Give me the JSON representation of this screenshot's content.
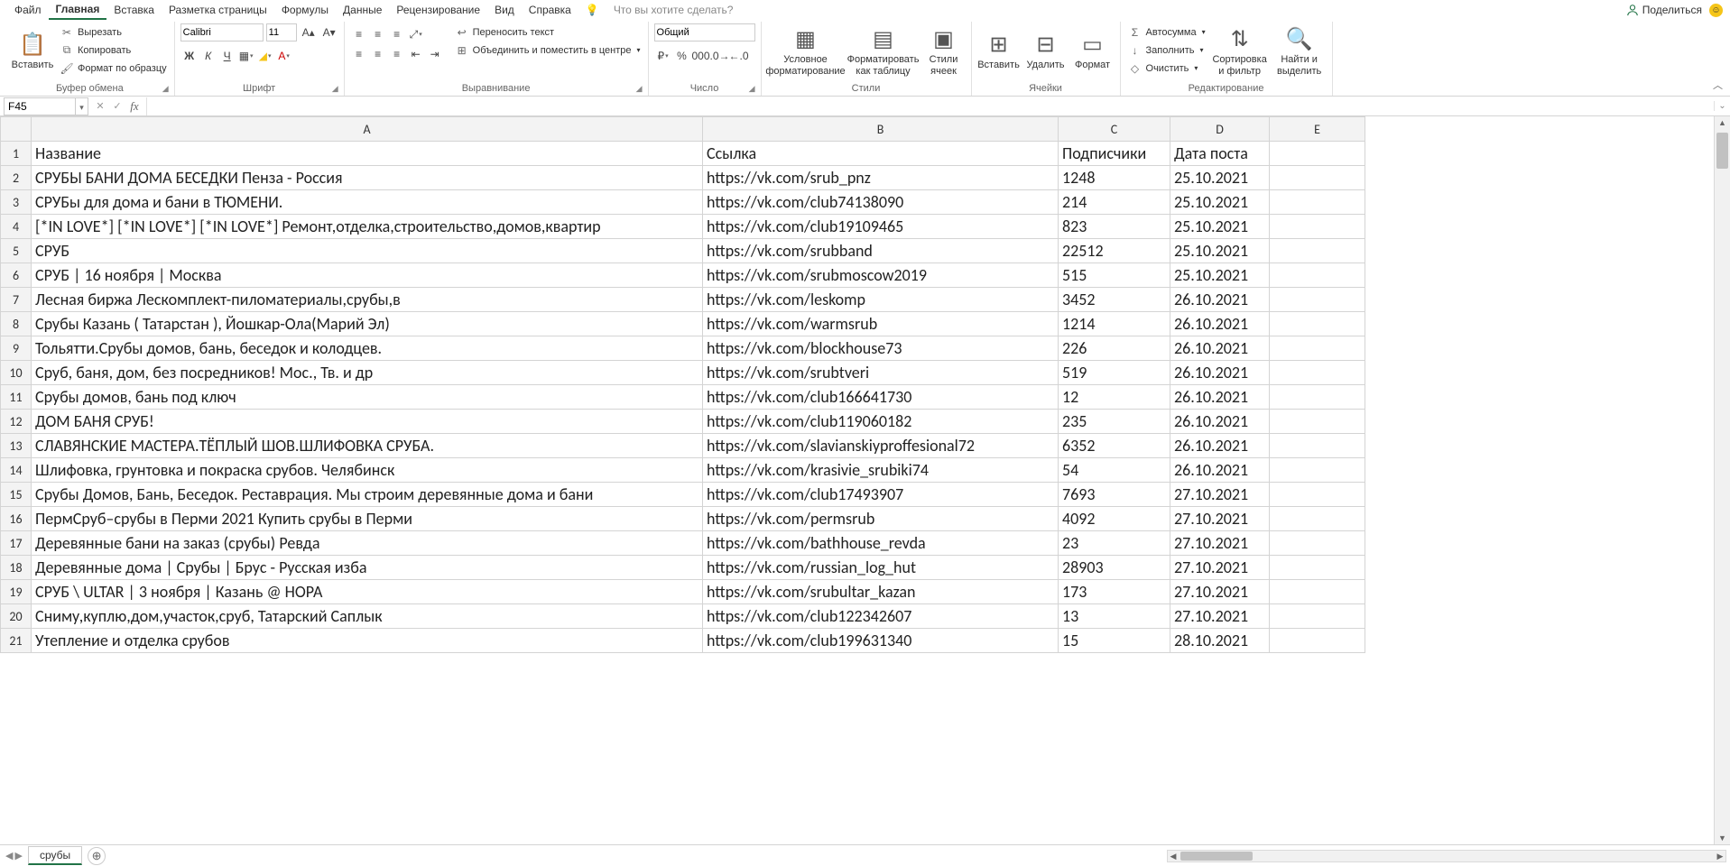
{
  "menu": {
    "tabs": [
      "Файл",
      "Главная",
      "Вставка",
      "Разметка страницы",
      "Формулы",
      "Данные",
      "Рецензирование",
      "Вид",
      "Справка"
    ],
    "active_index": 1,
    "tell_me": "Что вы хотите сделать?",
    "share": "Поделиться"
  },
  "ribbon": {
    "clipboard": {
      "paste": "Вставить",
      "cut": "Вырезать",
      "copy": "Копировать",
      "format_painter": "Формат по образцу",
      "label": "Буфер обмена"
    },
    "font": {
      "name": "Calibri",
      "size": "11",
      "label": "Шрифт"
    },
    "alignment": {
      "wrap": "Переносить текст",
      "merge": "Объединить и поместить в центре",
      "label": "Выравнивание"
    },
    "number": {
      "format": "Общий",
      "label": "Число"
    },
    "styles": {
      "conditional": "Условное форматирование",
      "as_table": "Форматировать как таблицу",
      "cell_styles": "Стили ячеек",
      "label": "Стили"
    },
    "cells": {
      "insert": "Вставить",
      "delete": "Удалить",
      "format": "Формат",
      "label": "Ячейки"
    },
    "editing": {
      "autosum": "Автосумма",
      "fill": "Заполнить",
      "clear": "Очистить",
      "sort": "Сортировка и фильтр",
      "find": "Найти и выделить",
      "label": "Редактирование"
    }
  },
  "namebox": "F45",
  "formula": "",
  "columns": [
    "A",
    "B",
    "C",
    "D",
    "E"
  ],
  "headers": {
    "A": "Название",
    "B": "Ссылка",
    "C": "Подписчики",
    "D": "Дата поста"
  },
  "rows": [
    {
      "n": 1,
      "A": "Название",
      "B": "Ссылка",
      "C": "Подписчики",
      "CT": "text",
      "D": "Дата поста"
    },
    {
      "n": 2,
      "A": "СРУБЫ БАНИ ДОМА БЕСЕДКИ Пенза - Россия",
      "B": "https://vk.com/srub_pnz",
      "C": "1248",
      "D": "25.10.2021"
    },
    {
      "n": 3,
      "A": "СРУБы для дома и бани в ТЮМЕНИ.",
      "B": "https://vk.com/club74138090",
      "C": "214",
      "D": "25.10.2021"
    },
    {
      "n": 4,
      "A": "[*IN LOVE*] [*IN LOVE*] [*IN LOVE*] Ремонт,отделка,строительство,домов,квартир",
      "B": "https://vk.com/club19109465",
      "C": "823",
      "D": "25.10.2021"
    },
    {
      "n": 5,
      "A": "СРУБ",
      "B": "https://vk.com/srubband",
      "C": "22512",
      "D": "25.10.2021"
    },
    {
      "n": 6,
      "A": "СРУБ | 16 ноября | Москва",
      "B": "https://vk.com/srubmoscow2019",
      "C": "515",
      "D": "25.10.2021"
    },
    {
      "n": 7,
      "A": "Лесная биржа Лескомплект-пиломатериалы,срубы,в",
      "B": "https://vk.com/leskomp",
      "C": "3452",
      "D": "26.10.2021"
    },
    {
      "n": 8,
      "A": "Срубы Казань ( Татарстан ), Йошкар-Ола(Марий Эл)",
      "B": "https://vk.com/warmsrub",
      "C": "1214",
      "D": "26.10.2021"
    },
    {
      "n": 9,
      "A": "Тольятти.Срубы домов, бань, беседок и колодцев.",
      "B": "https://vk.com/blockhouse73",
      "C": "226",
      "D": "26.10.2021"
    },
    {
      "n": 10,
      "A": "Сруб, баня, дом, без посредников! Мос., Тв. и др",
      "B": "https://vk.com/srubtveri",
      "C": "519",
      "D": "26.10.2021"
    },
    {
      "n": 11,
      "A": "Срубы домов, бань под ключ",
      "B": "https://vk.com/club166641730",
      "C": "12",
      "D": "26.10.2021"
    },
    {
      "n": 12,
      "A": "ДОМ БАНЯ СРУБ!",
      "B": "https://vk.com/club119060182",
      "C": "235",
      "D": "26.10.2021"
    },
    {
      "n": 13,
      "A": "СЛАВЯНСКИЕ МАСТЕРА.ТЁПЛЫЙ ШОВ.ШЛИФОВКА СРУБА.",
      "B": "https://vk.com/slavianskiyproffesional72",
      "C": "6352",
      "D": "26.10.2021"
    },
    {
      "n": 14,
      "A": "Шлифовка, грунтовка и покраска срубов. Челябинск",
      "B": "https://vk.com/krasivie_srubiki74",
      "C": "54",
      "D": "26.10.2021"
    },
    {
      "n": 15,
      "A": "Срубы Домов, Бань, Беседок. Реставрация. Мы строим деревянные дома и бани",
      "B": "https://vk.com/club17493907",
      "C": "7693",
      "D": "27.10.2021"
    },
    {
      "n": 16,
      "A": "ПермСруб–срубы в Перми 2021 Купить срубы в Перми",
      "B": "https://vk.com/permsrub",
      "C": "4092",
      "D": "27.10.2021"
    },
    {
      "n": 17,
      "A": "Деревянные бани на заказ (срубы) Ревда",
      "B": "https://vk.com/bathhouse_revda",
      "C": "23",
      "D": "27.10.2021"
    },
    {
      "n": 18,
      "A": "Деревянные дома | Срубы | Брус - Русская изба",
      "B": "https://vk.com/russian_log_hut",
      "C": "28903",
      "D": "27.10.2021"
    },
    {
      "n": 19,
      "A": "СРУБ \\ ULTAR | 3 ноября | Казань @ НОРА",
      "B": "https://vk.com/srubultar_kazan",
      "C": "173",
      "D": "27.10.2021"
    },
    {
      "n": 20,
      "A": "Сниму,куплю,дом,участок,сруб, Татарский Саплык",
      "B": "https://vk.com/club122342607",
      "C": "13",
      "D": "27.10.2021"
    },
    {
      "n": 21,
      "A": "Утепление и отделка срубов",
      "B": "https://vk.com/club199631340",
      "C": "15",
      "D": "28.10.2021"
    }
  ],
  "sheet_tab": "срубы"
}
